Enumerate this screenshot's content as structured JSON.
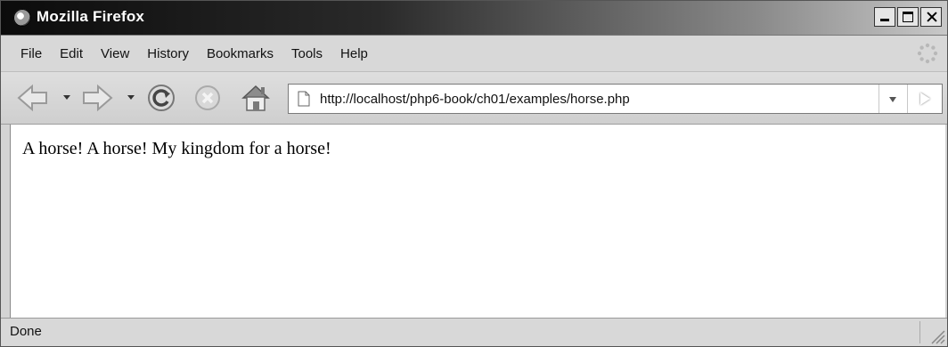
{
  "window": {
    "title": "Mozilla Firefox"
  },
  "menu": {
    "items": [
      "File",
      "Edit",
      "View",
      "History",
      "Bookmarks",
      "Tools",
      "Help"
    ]
  },
  "toolbar": {
    "url": "http://localhost/php6-book/ch01/examples/horse.php",
    "icons": [
      "back-icon",
      "forward-icon",
      "reload-icon",
      "stop-icon",
      "home-icon",
      "page-icon",
      "go-icon"
    ]
  },
  "content": {
    "text": "A horse! A horse! My kingdom for a horse!"
  },
  "status": {
    "text": "Done"
  },
  "colors": {
    "titlebar_dark": "#0b0b0b",
    "chrome": "#d4d4d4",
    "content_bg": "#ffffff"
  }
}
